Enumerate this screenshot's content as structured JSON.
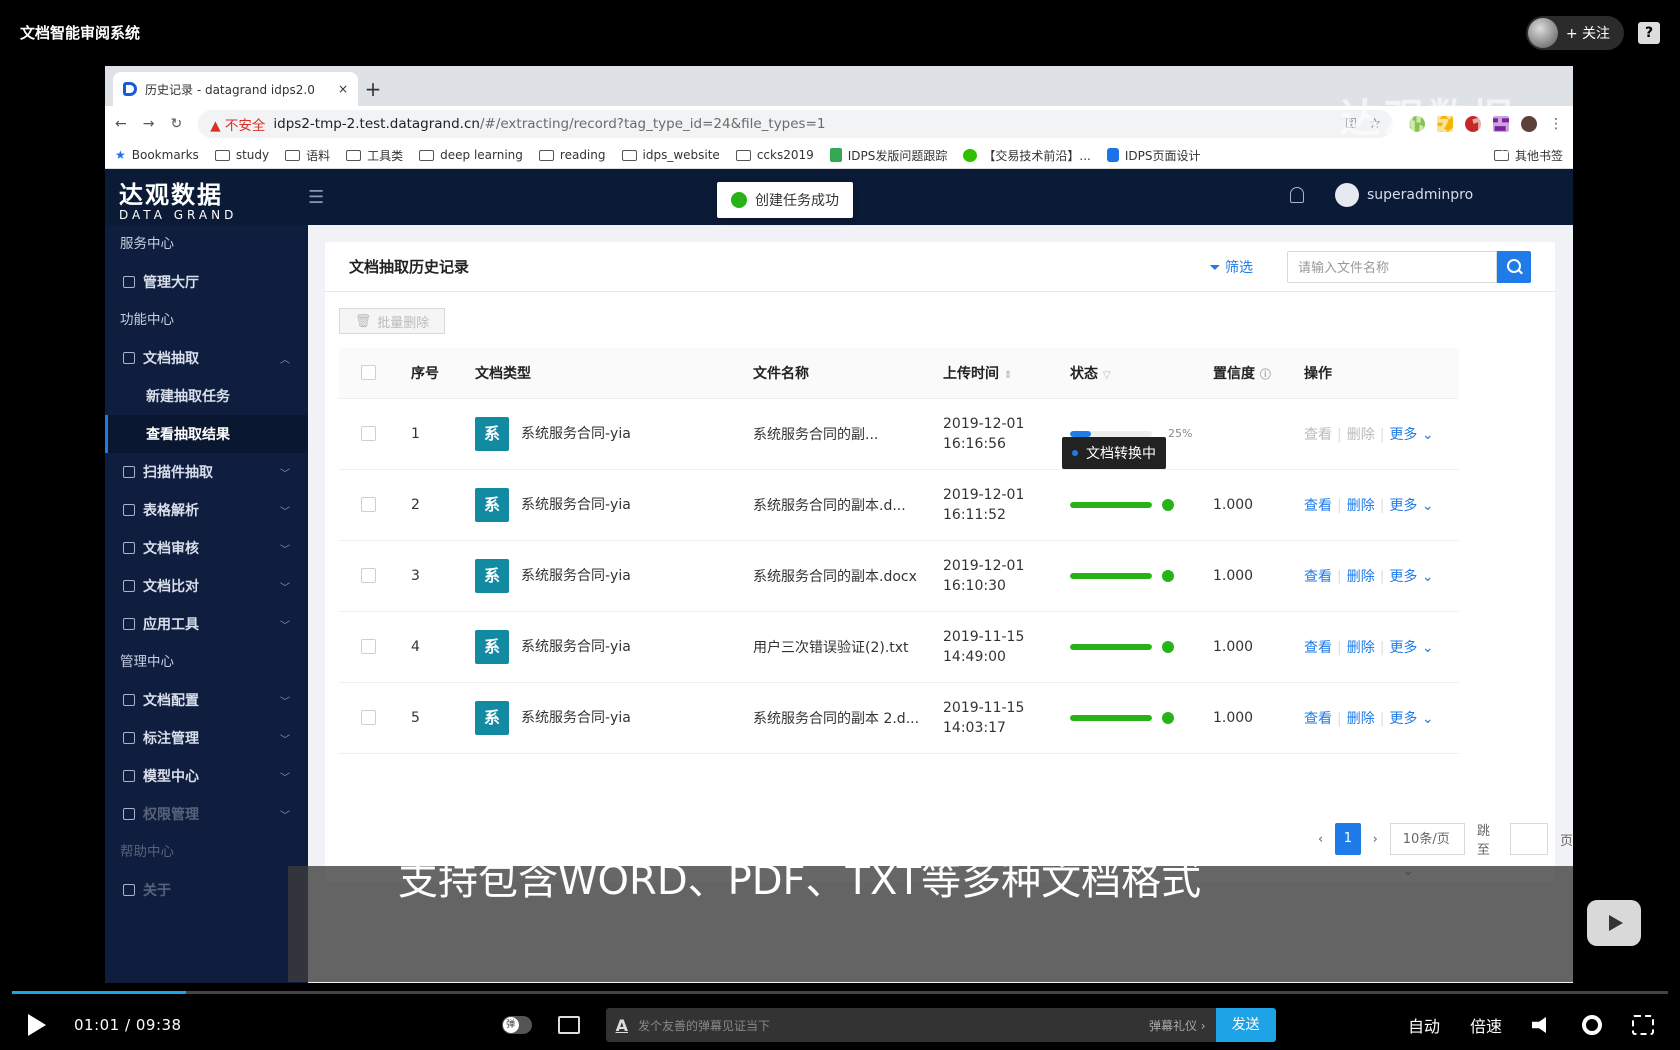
{
  "video": {
    "title": "文档智能审阅系统",
    "follow_label": "+ 关注",
    "help": "?",
    "subtitle": "支持包含WORD、PDF、TXT等多种文档格式",
    "current_time": "01:01",
    "duration": "09:38",
    "time_sep": "/",
    "progress": 0.105,
    "danmu_placeholder": "发个友善的弹幕见证当下",
    "danmu_gift": "弹幕礼仪 ›",
    "danmu_icon": "A",
    "send_label": "发送",
    "auto_label": "自动",
    "speed_label": "倍速",
    "watermark_cn": "达观数据",
    "watermark_en": "DATA GRAND"
  },
  "browser": {
    "tab_title": "历史记录 - datagrand idps2.0",
    "tab_close": "×",
    "new_tab": "+",
    "insecure": "▲ 不安全",
    "url_host": "idps2-tmp-2.test.datagrand.cn",
    "url_path": "/#/extracting/record?tag_type_id=24&file_types=1",
    "bookmarks": [
      "Bookmarks",
      "study",
      "语料",
      "工具类",
      "deep learning",
      "reading",
      "idps_website",
      "ccks2019",
      "IDPS发版问题跟踪",
      "【交易技术前沿】...",
      "IDPS页面设计"
    ],
    "other_bookmarks": "其他书签"
  },
  "app": {
    "logo_cn": "达观数据",
    "logo_en": "DATA GRAND",
    "username": "superadminpro",
    "toast": "创建任务成功",
    "sidebar": {
      "service_center": "服务中心",
      "dashboard": "管理大厅",
      "function_center": "功能中心",
      "doc_extract": "文档抽取",
      "new_task": "新建抽取任务",
      "view_results": "查看抽取结果",
      "scan_extract": "扫描件抽取",
      "table_parse": "表格解析",
      "doc_review": "文档审核",
      "doc_compare": "文档比对",
      "app_tools": "应用工具",
      "admin_center": "管理中心",
      "doc_config": "文档配置",
      "label_mgmt": "标注管理",
      "model_center": "模型中心",
      "permission_mgmt": "权限管理",
      "help_center": "帮助中心",
      "about": "关于"
    },
    "page_title": "文档抽取历史记录",
    "filter_label": "筛选",
    "search_placeholder": "请输入文件名称",
    "bulk_delete": "批量删除",
    "columns": [
      "序号",
      "文档类型",
      "文件名称",
      "上传时间",
      "状态",
      "置信度",
      "操作"
    ],
    "tooltip": "文档转换中",
    "rows": [
      {
        "no": "1",
        "badge": "系",
        "type": "系统服务合同-yia",
        "name": "系统服务合同的副...",
        "date": "2019-12-01",
        "time": "16:16:56",
        "progress": 0.25,
        "pct": "25%",
        "confidence": "",
        "done": false
      },
      {
        "no": "2",
        "badge": "系",
        "type": "系统服务合同-yia",
        "name": "系统服务合同的副本.d...",
        "date": "2019-12-01",
        "time": "16:11:52",
        "progress": 1.0,
        "pct": "",
        "confidence": "1.000",
        "done": true
      },
      {
        "no": "3",
        "badge": "系",
        "type": "系统服务合同-yia",
        "name": "系统服务合同的副本.docx",
        "date": "2019-12-01",
        "time": "16:10:30",
        "progress": 1.0,
        "pct": "",
        "confidence": "1.000",
        "done": true
      },
      {
        "no": "4",
        "badge": "系",
        "type": "系统服务合同-yia",
        "name": "用户三次错误验证(2).txt",
        "date": "2019-11-15",
        "time": "14:49:00",
        "progress": 1.0,
        "pct": "",
        "confidence": "1.000",
        "done": true
      },
      {
        "no": "5",
        "badge": "系",
        "type": "系统服务合同-yia",
        "name": "系统服务合同的副本 2.d...",
        "date": "2019-11-15",
        "time": "14:03:17",
        "progress": 1.0,
        "pct": "",
        "confidence": "1.000",
        "done": true
      }
    ],
    "ops": {
      "view": "查看",
      "delete": "删除",
      "more": "更多 ⌄"
    },
    "pagination": {
      "prev": "‹",
      "page": "1",
      "next": "›",
      "page_size": "10条/页 ⌄",
      "jump_label": "跳至",
      "page_unit": "页"
    }
  },
  "colors": {
    "accent": "#1f7be8",
    "success": "#27b217",
    "doc_badge": "#128aa2",
    "nav_bg": "#0f1e3e",
    "header_bg": "#0b1a36",
    "player_accent": "#1ea3e6"
  }
}
